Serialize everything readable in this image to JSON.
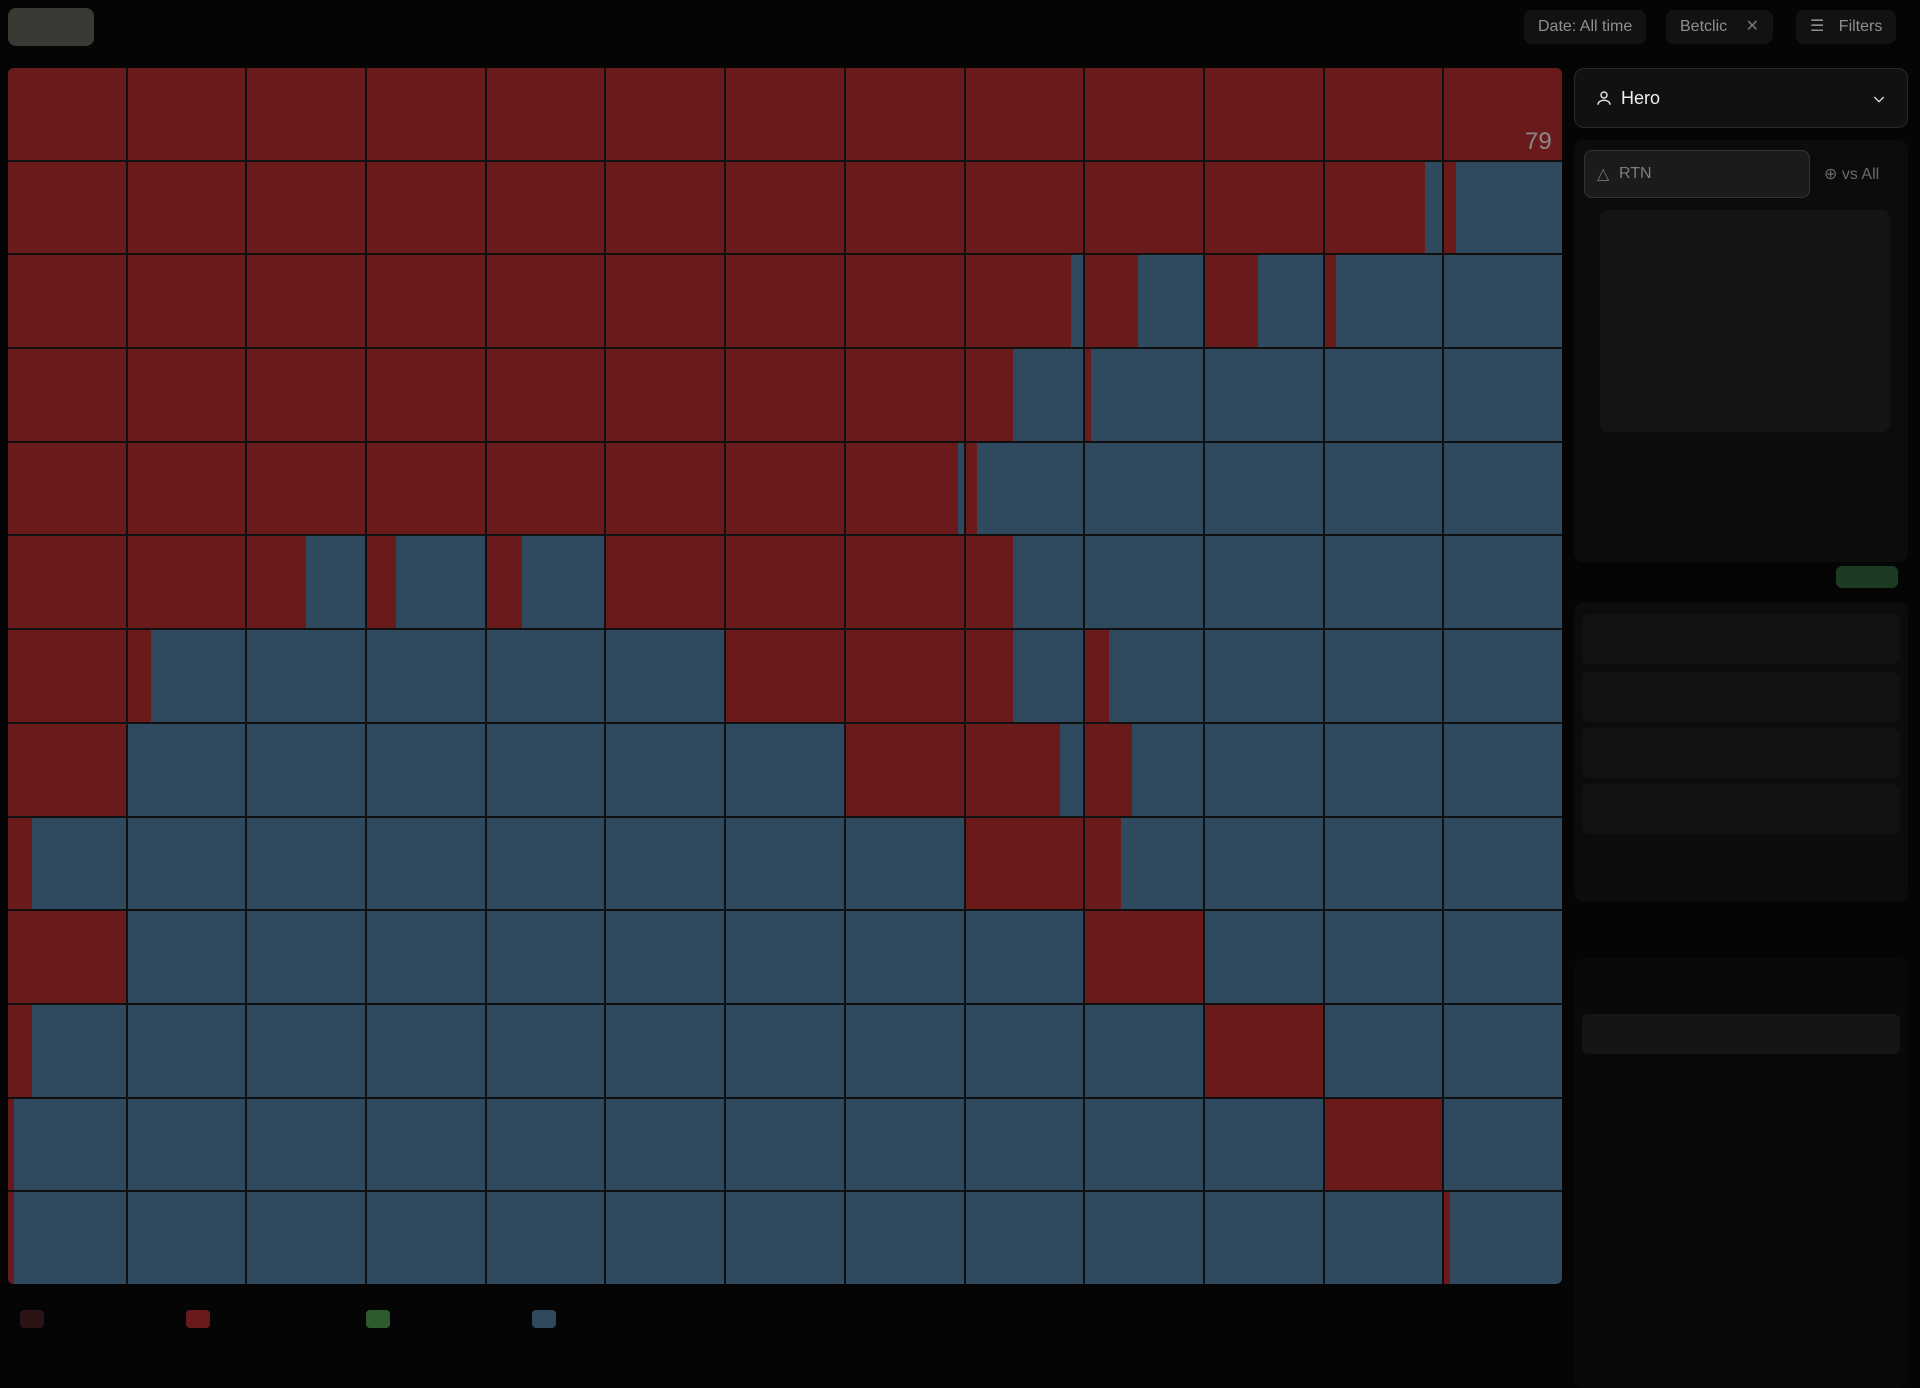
{
  "top_tabs": [
    "",
    "",
    "",
    ""
  ],
  "filters": {
    "date_label": "Date: All time",
    "room_chip": "Betclic",
    "filters_button": "Filters"
  },
  "grid": {
    "rows": 13,
    "cols": 13,
    "corner_number": "79",
    "cells": [
      [
        100,
        100,
        100,
        100,
        100,
        100,
        100,
        100,
        100,
        100,
        100,
        100,
        100
      ],
      [
        100,
        100,
        100,
        100,
        100,
        100,
        100,
        100,
        100,
        100,
        100,
        85,
        10
      ],
      [
        100,
        100,
        100,
        100,
        100,
        100,
        100,
        100,
        90,
        45,
        45,
        10,
        0
      ],
      [
        100,
        100,
        100,
        100,
        100,
        100,
        100,
        100,
        40,
        5,
        0,
        0,
        0
      ],
      [
        100,
        100,
        100,
        100,
        100,
        100,
        100,
        95,
        10,
        0,
        0,
        0,
        0
      ],
      [
        100,
        100,
        50,
        25,
        30,
        100,
        100,
        100,
        40,
        0,
        0,
        0,
        0
      ],
      [
        100,
        20,
        0,
        0,
        0,
        0,
        100,
        100,
        40,
        20,
        0,
        0,
        0
      ],
      [
        100,
        0,
        0,
        0,
        0,
        0,
        0,
        100,
        80,
        40,
        0,
        0,
        0
      ],
      [
        20,
        0,
        0,
        0,
        0,
        0,
        0,
        0,
        100,
        30,
        0,
        0,
        0
      ],
      [
        100,
        0,
        0,
        0,
        0,
        0,
        0,
        0,
        0,
        100,
        0,
        0,
        0
      ],
      [
        20,
        0,
        0,
        0,
        0,
        0,
        0,
        0,
        0,
        0,
        100,
        0,
        0
      ],
      [
        5,
        0,
        0,
        0,
        0,
        0,
        0,
        0,
        0,
        0,
        0,
        100,
        0
      ],
      [
        5,
        0,
        0,
        0,
        0,
        0,
        0,
        0,
        0,
        0,
        0,
        0,
        5
      ]
    ]
  },
  "sidebar": {
    "player_name": "Hero",
    "position_label": "RTN",
    "vs_label": "vs All",
    "menu_items": [
      "",
      "",
      "",
      "",
      ""
    ],
    "list_items": [
      "",
      "",
      "",
      "",
      "",
      "",
      ""
    ]
  },
  "colors": {
    "raise": "#6b1a1c",
    "fold": "#2f4a5e"
  }
}
